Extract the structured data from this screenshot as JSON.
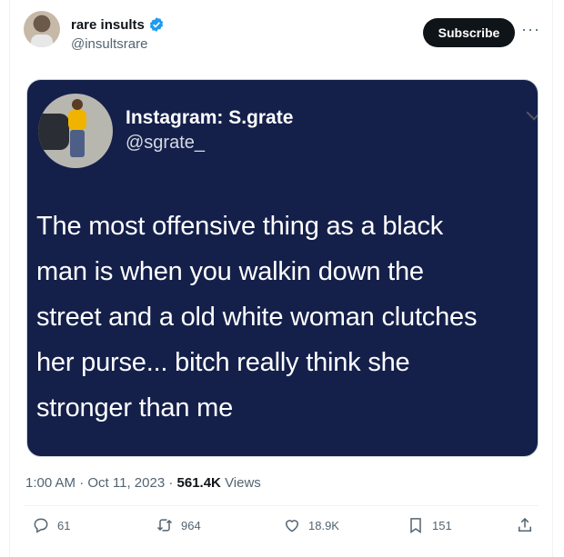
{
  "author": {
    "name": "rare insults",
    "handle": "@insultsrare"
  },
  "subscribe_label": "Subscribe",
  "more_label": "···",
  "embedded": {
    "title": "Instagram: S.grate",
    "handle": "@sgrate_",
    "text": "The most offensive thing as a black\nman is when you walkin down the\nstreet and a old white woman clutches\nher purse... bitch really think she\nstronger than me"
  },
  "meta": {
    "time": "1:00 AM",
    "date": "Oct 11, 2023",
    "views_count": "561.4K",
    "views_label": "Views"
  },
  "actions": {
    "replies": "61",
    "reposts": "964",
    "likes": "18.9K",
    "bookmarks": "151"
  },
  "colors": {
    "verified": "#1d9bf0",
    "media_bg": "#14204a",
    "muted": "#536471"
  },
  "icons": [
    "verified-badge-icon",
    "reply-icon",
    "repost-icon",
    "like-icon",
    "bookmark-icon",
    "share-icon",
    "more-icon"
  ]
}
